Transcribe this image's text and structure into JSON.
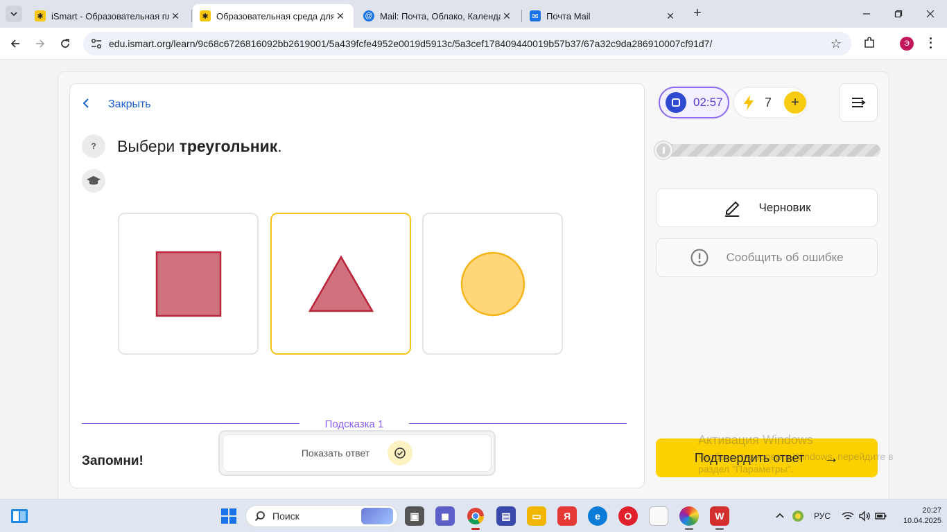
{
  "browser": {
    "tabs": [
      {
        "title": "iSmart - Образовательная пла",
        "favicon_color": "#f9c80e"
      },
      {
        "title": "Образовательная среда для са",
        "favicon_color": "#f9c80e"
      },
      {
        "title": "Mail: Почта, Облако, Календар",
        "favicon_color": "#1a73e8"
      },
      {
        "title": "Почта Mail",
        "favicon_color": "#1a73e8"
      }
    ],
    "active_tab": 1,
    "url": "edu.ismart.org/learn/9c68c6726816092bb2619001/5a439fcfe4952e0019d5913c/5a3cef178409440019b57b37/67a32c9da286910007cf91d7/",
    "profile_initial": "Э"
  },
  "task": {
    "close_label": "Закрыть",
    "help_symbol": "?",
    "question_prefix": "Выбери ",
    "question_bold": "треугольник",
    "question_suffix": ".",
    "options": [
      {
        "shape": "square",
        "fill": "#d1717e",
        "stroke": "#b8243a",
        "selected": false
      },
      {
        "shape": "triangle",
        "fill": "#d1717e",
        "stroke": "#b8243a",
        "selected": true
      },
      {
        "shape": "circle",
        "fill": "#ffd77a",
        "stroke": "#f5b51a",
        "selected": false
      }
    ],
    "hint_label": "Подсказка  1",
    "remember_label": "Запомни!",
    "show_answer_label": "Показать ответ"
  },
  "sidebar": {
    "timer": "02:57",
    "energy_count": "7",
    "energy_plus": "+",
    "progress_percent": 0,
    "draft_label": "Черновик",
    "report_label": "Сообщить об ошибке",
    "confirm_label": "Подтвердить ответ",
    "confirm_arrow": "→"
  },
  "watermark": {
    "title": "Активация Windows",
    "text": "Чтобы активировать Windows, перейдите в раздел \"Параметры\"."
  },
  "taskbar": {
    "search_label": "Поиск",
    "language": "РУС",
    "time": "20:27",
    "date": "10.04.2025"
  },
  "colors": {
    "accent_yellow": "#fdd000",
    "accent_purple": "#8b6cf0",
    "link_blue": "#1a5fd0"
  }
}
